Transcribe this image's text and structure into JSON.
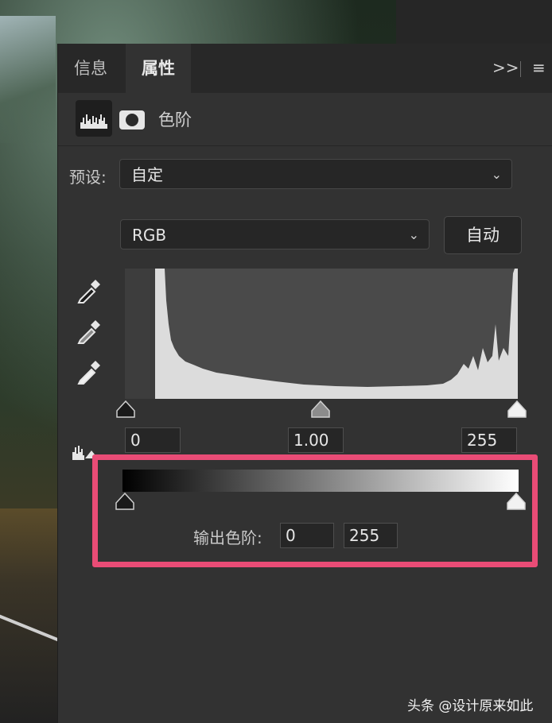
{
  "tabs": [
    {
      "label": "信息",
      "active": false
    },
    {
      "label": "属性",
      "active": true
    }
  ],
  "panel_controls": {
    "collapse": ">>",
    "menu": "≡"
  },
  "header": {
    "title": "色阶",
    "icons": [
      "histogram-icon",
      "mask-icon"
    ]
  },
  "preset": {
    "label": "预设:",
    "value": "自定"
  },
  "channel": {
    "value": "RGB"
  },
  "auto_button": {
    "label": "自动"
  },
  "pickers": [
    "eyedropper-black-icon",
    "eyedropper-gray-icon",
    "eyedropper-white-icon"
  ],
  "input_levels": {
    "black": "0",
    "gamma": "1.00",
    "white": "255"
  },
  "output_levels": {
    "label": "输出色阶:",
    "black": "0",
    "white": "255"
  },
  "highlight_color": "#e94c76",
  "watermark": "头条 @设计原来如此"
}
